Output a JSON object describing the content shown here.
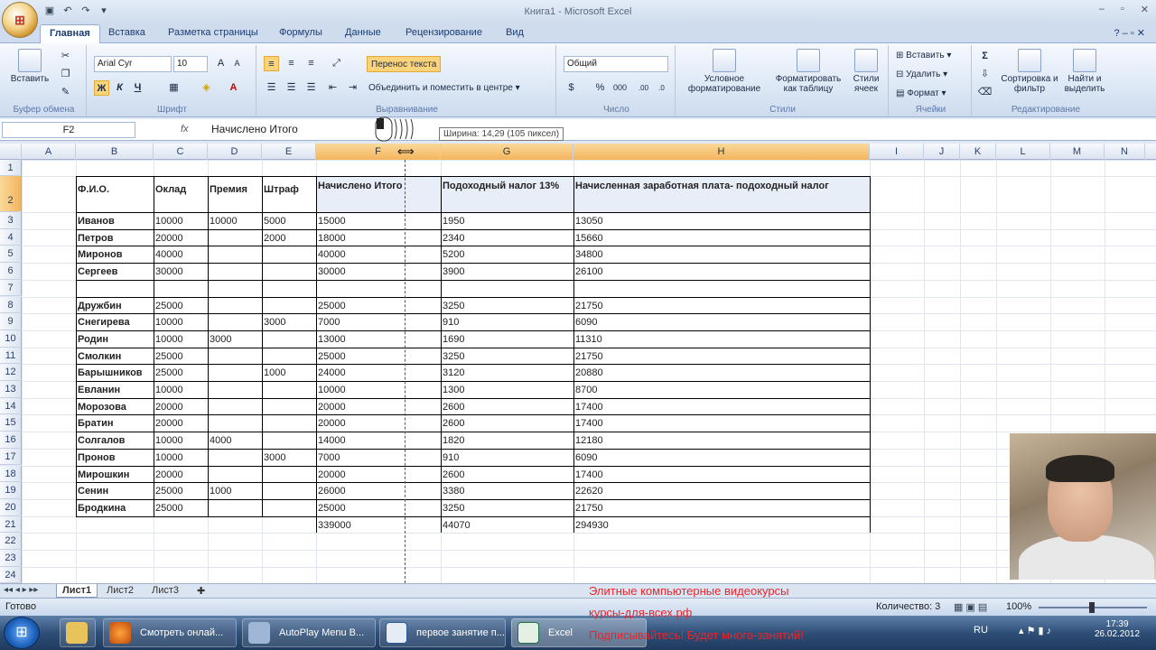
{
  "window": {
    "title": "Книга1 - Microsoft Excel"
  },
  "ribbon_tabs": [
    "Главная",
    "Вставка",
    "Разметка страницы",
    "Формулы",
    "Данные",
    "Рецензирование",
    "Вид"
  ],
  "ribbon": {
    "clipboard": {
      "paste": "Вставить",
      "group": "Буфер обмена"
    },
    "font": {
      "name": "Arial Cyr",
      "size": "10",
      "group": "Шрифт",
      "bold": "Ж",
      "italic": "К",
      "underline": "Ч"
    },
    "alignment": {
      "wrap": "Перенос текста",
      "merge": "Объединить и поместить в центре",
      "group": "Выравнивание"
    },
    "number": {
      "format": "Общий",
      "group": "Число"
    },
    "styles": {
      "cond": "Условное форматирование",
      "table": "Форматировать как таблицу",
      "cell": "Стили ячеек",
      "group": "Стили"
    },
    "cells": {
      "insert": "Вставить",
      "delete": "Удалить",
      "format": "Формат",
      "group": "Ячейки"
    },
    "editing": {
      "sort": "Сортировка и фильтр",
      "find": "Найти и выделить",
      "group": "Редактирование"
    }
  },
  "formula_bar": {
    "name_box": "F2",
    "fx": "fx",
    "value": "Начислено Итого"
  },
  "tooltip": "Ширина: 14,29 (105 пиксел)",
  "columns": [
    "A",
    "B",
    "C",
    "D",
    "E",
    "F",
    "G",
    "H",
    "I",
    "J",
    "K",
    "L",
    "M",
    "N"
  ],
  "rows": [
    "1",
    "2",
    "3",
    "4",
    "5",
    "6",
    "7",
    "8",
    "9",
    "10",
    "11",
    "12",
    "13",
    "14",
    "15",
    "16",
    "17",
    "18",
    "19",
    "20",
    "21",
    "22",
    "23",
    "24"
  ],
  "table": {
    "headers": [
      "Ф.И.О.",
      "Оклад",
      "Премия",
      "Штраф",
      "Начислено Итого",
      "Подоходный налог 13%",
      "Начисленная заработная плата- подоходный налог"
    ],
    "data": [
      [
        "Иванов",
        "10000",
        "10000",
        "5000",
        "15000",
        "1950",
        "13050"
      ],
      [
        "Петров",
        "20000",
        "",
        "2000",
        "18000",
        "2340",
        "15660"
      ],
      [
        "Миронов",
        "40000",
        "",
        "",
        "40000",
        "5200",
        "34800"
      ],
      [
        "Сергеев",
        "30000",
        "",
        "",
        "30000",
        "3900",
        "26100"
      ],
      [
        "",
        "",
        "",
        "",
        "",
        "",
        ""
      ],
      [
        "Дружбин",
        "25000",
        "",
        "",
        "25000",
        "3250",
        "21750"
      ],
      [
        "Снегирева",
        "10000",
        "",
        "3000",
        "7000",
        "910",
        "6090"
      ],
      [
        "Родин",
        "10000",
        "3000",
        "",
        "13000",
        "1690",
        "11310"
      ],
      [
        "Смолкин",
        "25000",
        "",
        "",
        "25000",
        "3250",
        "21750"
      ],
      [
        "Барышников",
        "25000",
        "",
        "1000",
        "24000",
        "3120",
        "20880"
      ],
      [
        "Евланин",
        "10000",
        "",
        "",
        "10000",
        "1300",
        "8700"
      ],
      [
        "Морозова",
        "20000",
        "",
        "",
        "20000",
        "2600",
        "17400"
      ],
      [
        "Братин",
        "20000",
        "",
        "",
        "20000",
        "2600",
        "17400"
      ],
      [
        "Солгалов",
        "10000",
        "4000",
        "",
        "14000",
        "1820",
        "12180"
      ],
      [
        "Пронов",
        "10000",
        "",
        "3000",
        "7000",
        "910",
        "6090"
      ],
      [
        "Мирошкин",
        "20000",
        "",
        "",
        "20000",
        "2600",
        "17400"
      ],
      [
        "Сенин",
        "25000",
        "1000",
        "",
        "26000",
        "3380",
        "22620"
      ],
      [
        "Бродкина",
        "25000",
        "",
        "",
        "25000",
        "3250",
        "21750"
      ]
    ],
    "totals": [
      "",
      "",
      "",
      "",
      "339000",
      "44070",
      "294930"
    ]
  },
  "sheet_tabs": [
    "Лист1",
    "Лист2",
    "Лист3"
  ],
  "status": {
    "ready": "Готово",
    "count": "Количество: 3",
    "zoom": "100%"
  },
  "taskbar": {
    "items": [
      "Смотреть онлай...",
      "AutoPlay Menu B...",
      "первое занятие п...",
      "Excel"
    ],
    "lang": "RU",
    "time": "17:39",
    "date": "26.02.2012"
  },
  "overlay": {
    "line1": "Элитные компьютерные видеокурсы",
    "line2": "курсы-для-всех.рф",
    "line3": "Подписывайтесь! Будет много-занятий!"
  }
}
